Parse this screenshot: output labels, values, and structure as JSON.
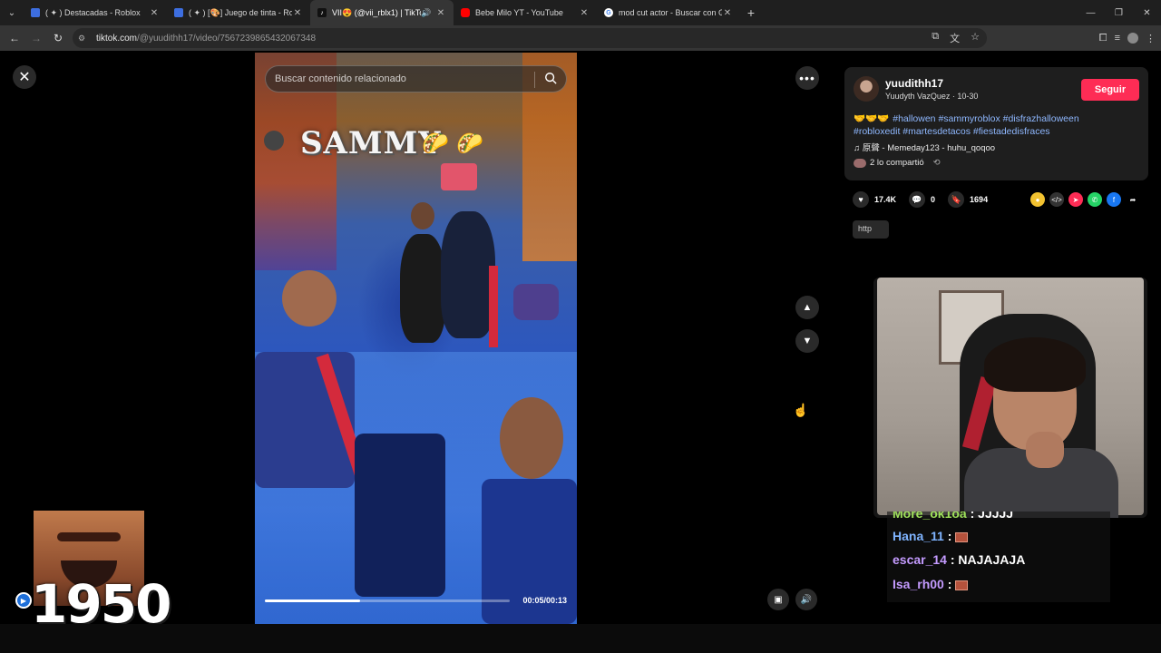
{
  "browser": {
    "tabs": [
      {
        "title": "( ✦ ) Destacadas - Roblox",
        "fav_color": "#3d6ee0",
        "active": false
      },
      {
        "title": "( ✦ ) [🎨] Juego de tinta - Roblox",
        "fav_color": "#3d6ee0",
        "active": false
      },
      {
        "title": "VII😍 (@vii_rblx1) | TikTok",
        "fav_color": "#111111",
        "active": true
      },
      {
        "title": "Bebe Milo YT - YouTube",
        "fav_color": "#ff0000",
        "active": false
      },
      {
        "title": "mod cut actor - Buscar con Google",
        "fav_color": "#ffffff",
        "active": false
      }
    ],
    "url_host": "tiktok.com",
    "url_path": "/@yuudithh17/video/7567239865432067348"
  },
  "video": {
    "search_placeholder": "Buscar contenido relacionado",
    "overlay_text": "SAMMY",
    "progress": 0.39,
    "time_label": "00:05/00:13"
  },
  "post": {
    "username": "yuudithh17",
    "display_meta": "Yuudyth VazQuez · 10-30",
    "follow_label": "Seguir",
    "caption_emojis": "🤝🤝🤝",
    "caption_line1": "#hallowen #sammyroblox #disfrazhalloween",
    "caption_line2": "#robloxedit #martesdetacos #fiestadedisfraces",
    "music": "♫  原聲 - Memeday123 - huhu_qoqoo",
    "shared": "2 lo compartió",
    "likes": "17.4K",
    "comments": "0",
    "saves": "1694",
    "link_stub": "http"
  },
  "chat": [
    {
      "user": "More_ok1oa",
      "sep": " : ",
      "msg": "JJJJJ",
      "color": "green"
    },
    {
      "user": "Hana_11",
      "sep": " : ",
      "msg": "",
      "color": "blue",
      "brick": true
    },
    {
      "user": "escar_14",
      "sep": " : ",
      "msg": "NAJAJAJA",
      "color": "purple"
    },
    {
      "user": "Isa_rh00",
      "sep": " : ",
      "msg": "",
      "color": "purple",
      "brick": true
    }
  ],
  "stream": {
    "counter": "1950"
  },
  "colors": {
    "follow": "#fe2c55",
    "hashtag": "#8fb8ff"
  }
}
